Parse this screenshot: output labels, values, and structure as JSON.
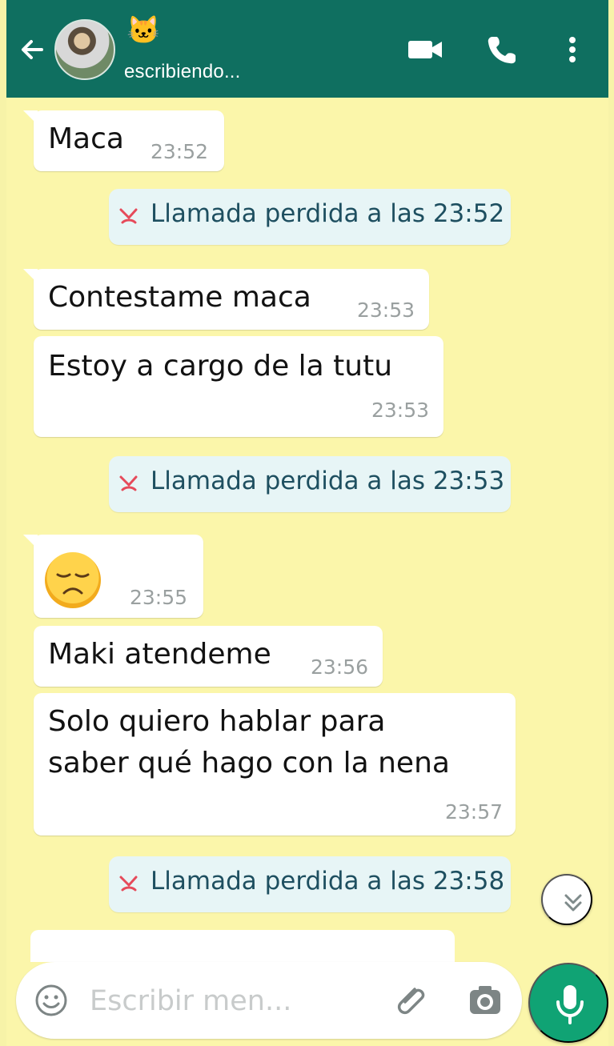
{
  "header": {
    "contact_emoji": "🐱",
    "status": "escribiendo...",
    "icons": [
      "back-arrow-icon",
      "video-call-icon",
      "voice-call-icon",
      "more-options-icon"
    ]
  },
  "messages": [
    {
      "text": "Maca",
      "time": "23:52"
    },
    {
      "missed_call": "Llamada perdida a las 23:52"
    },
    {
      "text": "Contestame maca",
      "time": "23:53"
    },
    {
      "text": "Estoy a cargo de la tutu",
      "time": "23:53"
    },
    {
      "missed_call": "Llamada perdida a las 23:53"
    },
    {
      "emoji": "😞",
      "time": "23:55"
    },
    {
      "text": "Maki atendeme",
      "time": "23:56"
    },
    {
      "text_line_1": "Solo quiero hablar para",
      "text_line_2": "saber qué hago con la nena",
      "time": "23:57"
    },
    {
      "missed_call": "Llamada perdida a las 23:58"
    }
  ],
  "composer": {
    "placeholder": "Escribir men...",
    "icons": [
      "emoji-icon",
      "attachment-icon",
      "camera-icon",
      "microphone-icon"
    ]
  },
  "colors": {
    "header": "#0f6f60",
    "chat_background": "#fbf6aa",
    "missed_call_background": "#e7f5f6",
    "mic_button": "#10a374"
  }
}
